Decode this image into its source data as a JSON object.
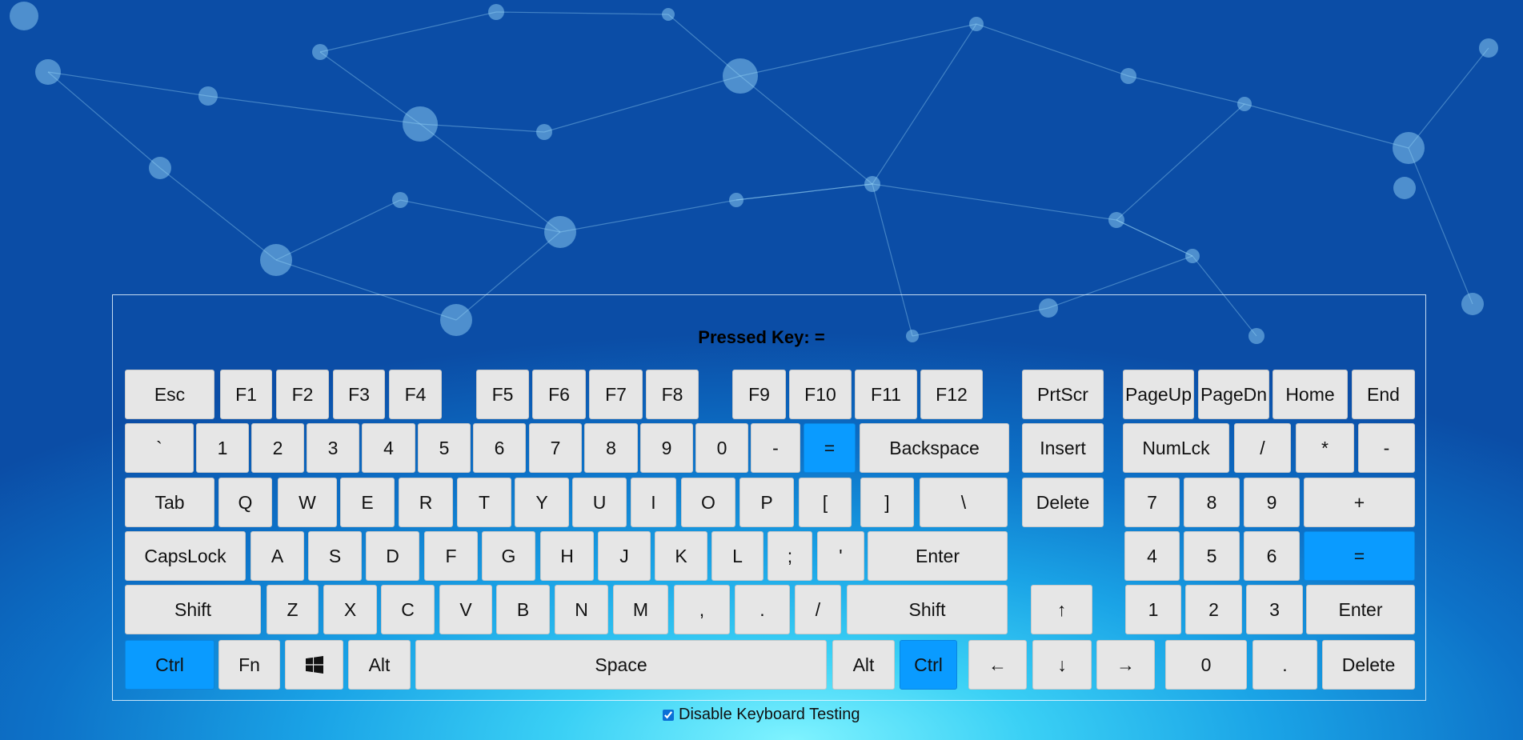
{
  "pressed": {
    "label": "Pressed Key:",
    "value": "="
  },
  "testing": {
    "label": "Disable Keyboard Testing",
    "checked": true
  },
  "colors": {
    "key": "#e6e6e6",
    "active_key": "#0a9bff"
  },
  "keyboard": {
    "function_row": [
      "Esc",
      "F1",
      "F2",
      "F3",
      "F4",
      "F5",
      "F6",
      "F7",
      "F8",
      "F9",
      "F10",
      "F11",
      "F12"
    ],
    "number_row": [
      "`",
      "1",
      "2",
      "3",
      "4",
      "5",
      "6",
      "7",
      "8",
      "9",
      "0",
      "-",
      "=",
      "Backspace"
    ],
    "top_row": [
      "Tab",
      "Q",
      "W",
      "E",
      "R",
      "T",
      "Y",
      "U",
      "I",
      "O",
      "P",
      "[",
      "]",
      "\\"
    ],
    "home_row": [
      "CapsLock",
      "A",
      "S",
      "D",
      "F",
      "G",
      "H",
      "J",
      "K",
      "L",
      ";",
      "'",
      "Enter"
    ],
    "bottom_row": [
      "Shift",
      "Z",
      "X",
      "C",
      "V",
      "B",
      "N",
      "M",
      ",",
      ".",
      "/",
      "Shift"
    ],
    "space_row": [
      "Ctrl",
      "Fn",
      "windows-icon",
      "Alt",
      "Space",
      "Alt",
      "Ctrl"
    ],
    "nav": [
      "PrtScr",
      "Insert",
      "Delete"
    ],
    "arrows": [
      "↑",
      "←",
      "↓",
      "→"
    ],
    "numpad": {
      "row0": [
        "PageUp",
        "PageDn",
        "Home",
        "End"
      ],
      "row1": [
        "NumLck",
        "/",
        "*",
        "-"
      ],
      "row2": [
        "7",
        "8",
        "9",
        "+"
      ],
      "row3": [
        "4",
        "5",
        "6",
        "="
      ],
      "row4": [
        "1",
        "2",
        "3",
        "Enter"
      ],
      "row5": [
        "0",
        ".",
        "Delete"
      ]
    },
    "active_keys": [
      "=",
      "numpad =",
      "left Ctrl",
      "right Ctrl"
    ]
  }
}
